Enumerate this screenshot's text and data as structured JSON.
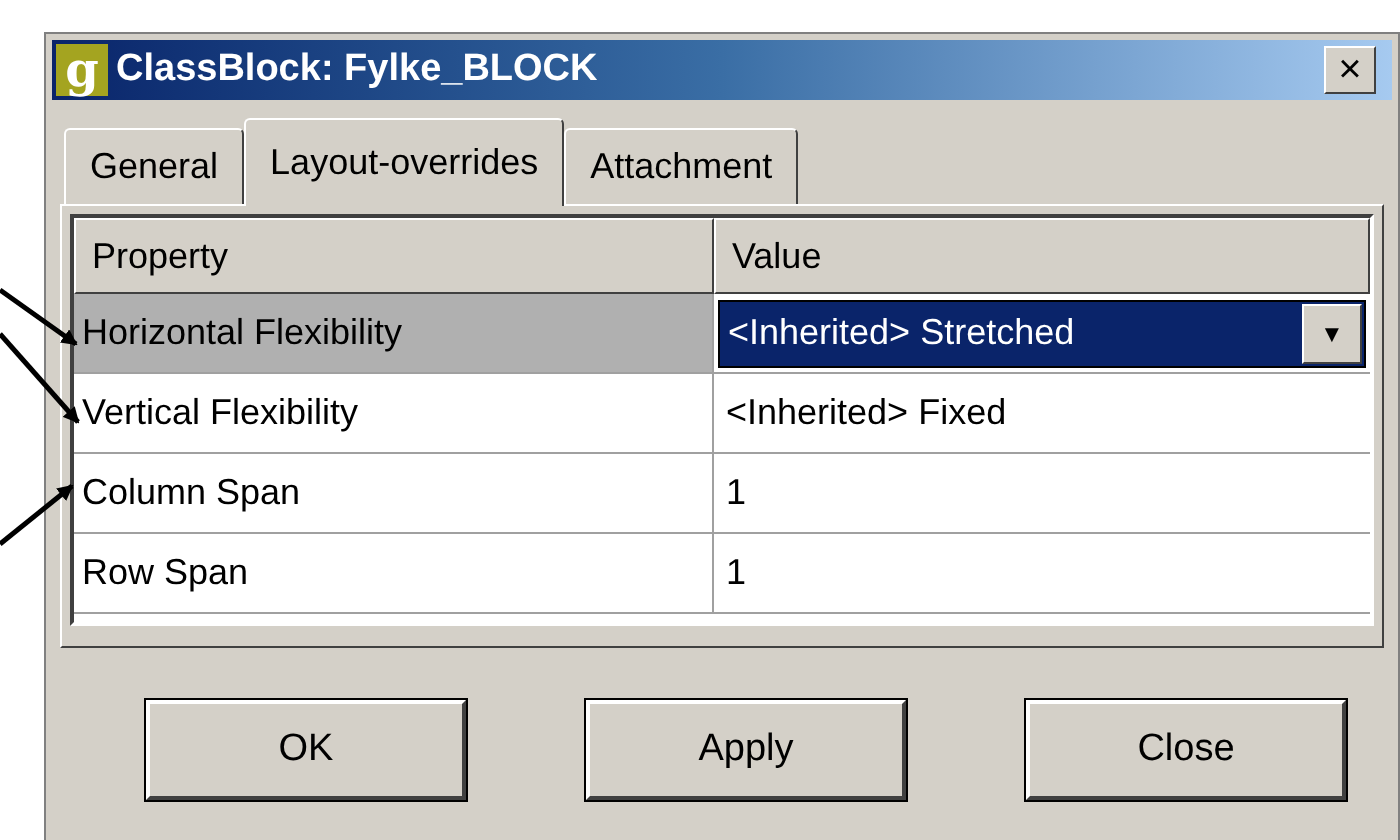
{
  "window": {
    "icon_letter": "g",
    "title": "ClassBlock: Fylke_BLOCK",
    "close": "×"
  },
  "tabs": [
    {
      "label": "General",
      "selected": false
    },
    {
      "label": "Layout-overrides",
      "selected": true
    },
    {
      "label": "Attachment",
      "selected": false
    }
  ],
  "table": {
    "columns": [
      "Property",
      "Value"
    ],
    "rows": [
      {
        "property": "Horizontal Flexibility",
        "value": "<Inherited> Stretched",
        "selected": true,
        "dropdown": "▼"
      },
      {
        "property": "Vertical Flexibility",
        "value": "<Inherited> Fixed",
        "selected": false
      },
      {
        "property": "Column Span",
        "value": "1",
        "selected": false
      },
      {
        "property": "Row Span",
        "value": "1",
        "selected": false
      }
    ]
  },
  "buttons": [
    "OK",
    "Apply",
    "Close"
  ]
}
